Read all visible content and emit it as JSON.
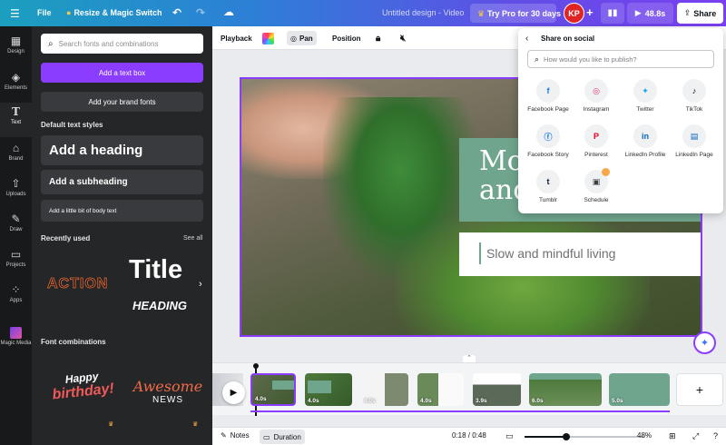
{
  "topbar": {
    "file_label": "File",
    "resize_label": "Resize & Magic Switch",
    "doc_title": "Untitled design - Video",
    "try_pro_label": "Try Pro for 30 days",
    "avatar_initials": "KP",
    "play_duration": "48.8s",
    "share_label": "Share"
  },
  "rail": {
    "items": [
      {
        "label": "Design",
        "icon": "layout-icon"
      },
      {
        "label": "Elements",
        "icon": "shapes-icon"
      },
      {
        "label": "Text",
        "icon": "text-icon"
      },
      {
        "label": "Brand",
        "icon": "brand-icon"
      },
      {
        "label": "Uploads",
        "icon": "upload-icon"
      },
      {
        "label": "Draw",
        "icon": "pen-icon"
      },
      {
        "label": "Projects",
        "icon": "folder-icon"
      },
      {
        "label": "Apps",
        "icon": "apps-icon"
      },
      {
        "label": "Magic Media",
        "icon": "magic-media-icon"
      }
    ]
  },
  "panel": {
    "search_placeholder": "Search fonts and combinations",
    "add_textbox": "Add a text box",
    "add_brand_fonts": "Add your brand fonts",
    "default_styles_title": "Default text styles",
    "heading": "Add a heading",
    "subheading": "Add a subheading",
    "body": "Add a little bit of body text",
    "recently_used_title": "Recently used",
    "see_all": "See all",
    "recent_action": "ACTION",
    "recent_title": "Title",
    "recent_heading": "HEADING",
    "font_combos_title": "Font combinations",
    "combo1_line1": "Happy",
    "combo1_line2": "birthday!",
    "combo2_line1": "Awesome",
    "combo2_line2": "NEWS"
  },
  "toolbar": {
    "playback": "Playback",
    "pan": "Pan",
    "position": "Position"
  },
  "slide": {
    "title_partial_1": "Mo",
    "title_partial_2": "and",
    "subtitle": "Slow and mindful living",
    "accent_green": "#6fa58d"
  },
  "share_popup": {
    "title": "Share on social",
    "search_placeholder": "How would you like to publish?",
    "options": [
      {
        "label": "Facebook Page",
        "icon": "facebook-icon",
        "color": "#1877f2"
      },
      {
        "label": "Instagram",
        "icon": "instagram-icon",
        "color": "#e1306c"
      },
      {
        "label": "Twitter",
        "icon": "twitter-icon",
        "color": "#1da1f2"
      },
      {
        "label": "TikTok",
        "icon": "tiktok-icon",
        "color": "#000000"
      },
      {
        "label": "Facebook Story",
        "icon": "facebook-story-icon",
        "color": "#1877f2"
      },
      {
        "label": "Pinterest",
        "icon": "pinterest-icon",
        "color": "#e60023"
      },
      {
        "label": "LinkedIn Profile",
        "icon": "linkedin-icon",
        "color": "#0a66c2"
      },
      {
        "label": "LinkedIn Page",
        "icon": "linkedin-page-icon",
        "color": "#0a66c2"
      },
      {
        "label": "Tumblr",
        "icon": "tumblr-icon",
        "color": "#001935"
      },
      {
        "label": "Schedule",
        "icon": "calendar-icon",
        "color": "#3c3f44"
      }
    ]
  },
  "timeline": {
    "clips": [
      {
        "duration": "4.0s"
      },
      {
        "duration": "4.0s"
      },
      {
        "duration": "4.0s"
      },
      {
        "duration": "4.0s"
      },
      {
        "duration": "3.9s"
      },
      {
        "duration": "6.0s"
      },
      {
        "duration": "5.0s"
      }
    ],
    "add_label": "+"
  },
  "bottombar": {
    "notes": "Notes",
    "duration": "Duration",
    "time": "0:18 / 0:48",
    "zoom": "48%"
  }
}
